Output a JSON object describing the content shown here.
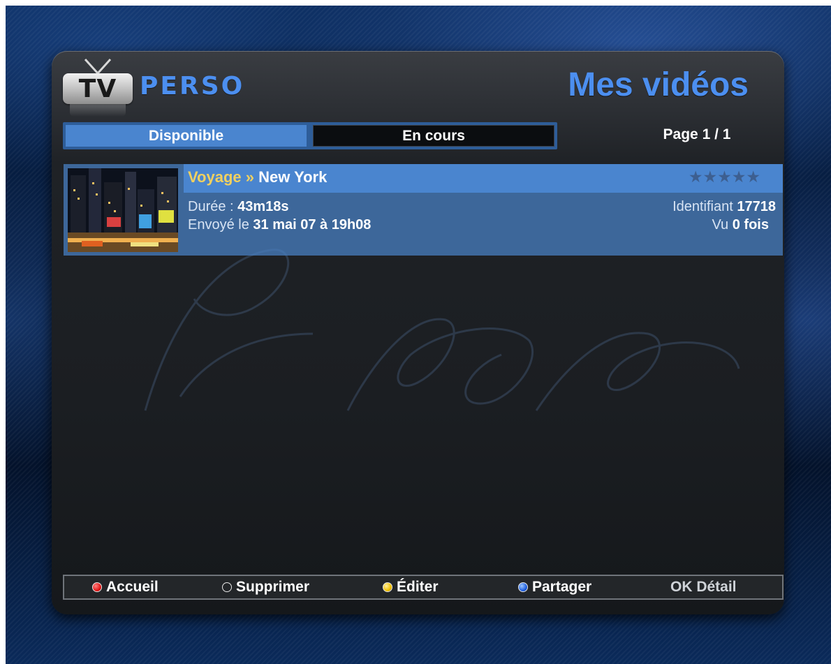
{
  "app": {
    "logo_left": "TV",
    "logo_right": "PERSO",
    "page_title": "Mes vidéos"
  },
  "tabs": [
    {
      "label": "Disponible",
      "active": true
    },
    {
      "label": "En cours",
      "active": false
    }
  ],
  "pagination": {
    "text": "Page 1 / 1"
  },
  "videos": [
    {
      "category": "Voyage",
      "separator": "»",
      "title": "New York",
      "rating_stars": 5,
      "rating_filled": 0,
      "duration_label": "Durée :",
      "duration_value": "43m18s",
      "sent_label": "Envoyé le",
      "sent_value": "31 mai 07 à 19h08",
      "id_label": "Identifiant",
      "id_value": "17718",
      "views_label": "Vu",
      "views_value": "0 fois"
    }
  ],
  "footer": [
    {
      "label": "Accueil",
      "color": "#e01818",
      "icon": "red-button-icon"
    },
    {
      "label": "Supprimer",
      "color": "#20c020",
      "icon": "green-button-icon"
    },
    {
      "label": "Éditer",
      "color": "#f0c000",
      "icon": "yellow-button-icon"
    },
    {
      "label": "Partager",
      "color": "#2060e0",
      "icon": "blue-button-icon"
    },
    {
      "label": "OK Détail",
      "color": null,
      "icon": null
    }
  ],
  "colors": {
    "accent": "#4c8ff0",
    "category": "#f0d060",
    "selection": "#4a85cf"
  }
}
